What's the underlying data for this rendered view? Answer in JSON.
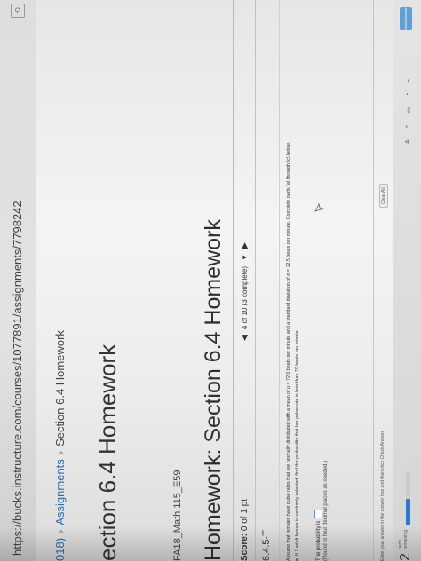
{
  "browser": {
    "url": "https://bucks.instructure.com/courses/1077891/assignments/7798242"
  },
  "breadcrumb": {
    "prefix": "018)",
    "sep": "›",
    "assignments": "Assignments",
    "current": "Section 6.4 Homework"
  },
  "course_heading": "ection 6.4 Homework",
  "course_name": "FA18_Math 115_E59",
  "homework": {
    "title": "Homework: Section 6.4 Homework",
    "score_label": "Score:",
    "score_value": "0 of 1 pt",
    "nav_status": "4 of 10 (3 complete)",
    "question_id": "6.4.5-T",
    "problem_text": "Assume that females have pulse rates that are normally distributed with a mean of μ = 72.0 beats per minute and a standard deviation of σ = 12.5 beats per minute. Complete parts (a) through (c) below.",
    "part_a_label": "a.",
    "part_a_text": "If 1 adult female is randomly selected, find the probability that her pulse rate is less than 79 beats per minute.",
    "answer_prompt": "The probability is",
    "answer_value": "",
    "round_note": "(Round to four decimal places as needed.)",
    "instruction": "Enter your answer in the answer box and then click Check Answer.",
    "clear_all": "Clear All",
    "check_answer": "Check Answer"
  },
  "footer": {
    "parts_count": "2",
    "parts_label_1": "parts",
    "parts_label_2": "remaining",
    "progress": 0.5
  },
  "icons": {
    "prev": "◀",
    "next": "▶",
    "caret": "▼",
    "ext": "⟲",
    "taskbar": [
      "A",
      "⌃",
      "▭",
      "◔",
      "⌁"
    ]
  },
  "colors": {
    "link": "#2a6db0",
    "progress": "#2b7bd1",
    "answer_border": "#5a8ed0"
  }
}
